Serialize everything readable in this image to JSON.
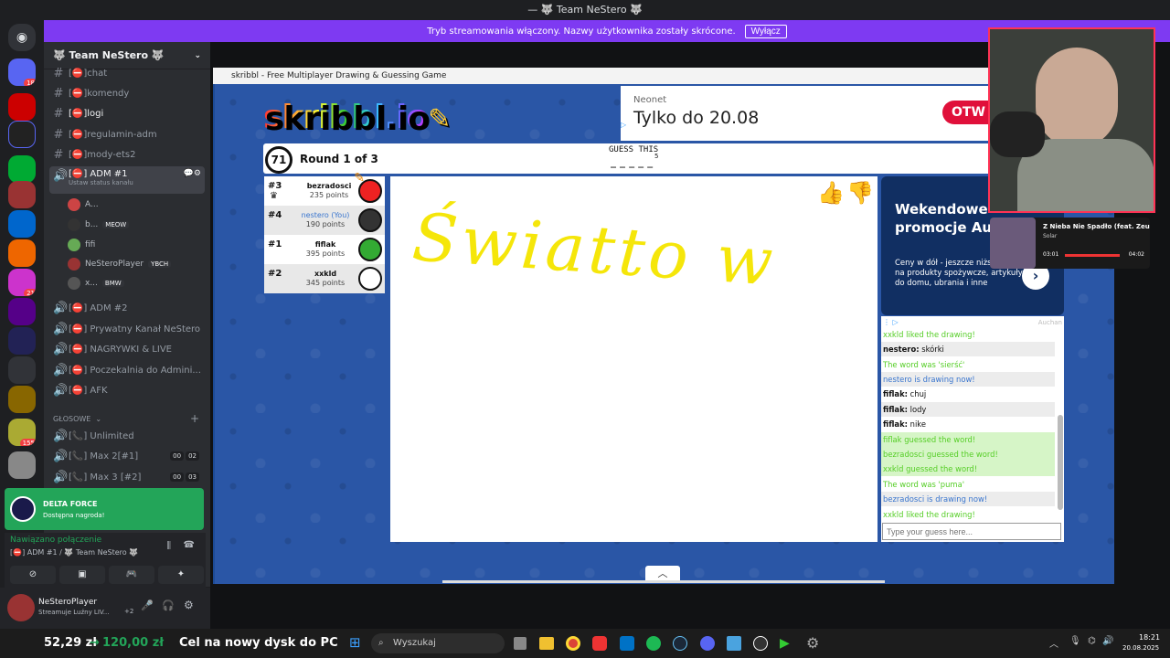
{
  "titlebar": {
    "title": "— 🐺 Team NeStero 🐺"
  },
  "banner": {
    "text": "Tryb streamowania włączony. Nazwy użytkownika zostały skrócone.",
    "button": "Wyłącz"
  },
  "server": {
    "name": "🐺 Team NeStero 🐺"
  },
  "channels": [
    {
      "label": "[⛔]chat",
      "type": "text"
    },
    {
      "label": "[⛔]komendy",
      "type": "text"
    },
    {
      "label": "[⛔]logi",
      "type": "text"
    },
    {
      "label": "[⛔]regulamin-adm",
      "type": "text"
    },
    {
      "label": "[⛔]mody-ets2",
      "type": "text"
    }
  ],
  "active_voice": {
    "label": "[⛔] ADM #1",
    "status": "Ustaw status kanału"
  },
  "voice_users": [
    {
      "name": "A...",
      "tag": ""
    },
    {
      "name": "b...",
      "tag": "MEOW"
    },
    {
      "name": "fifi",
      "tag": ""
    },
    {
      "name": "NeSteroPlayer",
      "tag": "YBCH"
    },
    {
      "name": "x...",
      "tag": "BMW"
    }
  ],
  "voice_channels": [
    {
      "label": "[⛔] ADM #2"
    },
    {
      "label": "[⛔] Prywatny Kanał NeStero"
    },
    {
      "label": "[⛔] NAGRYWKI & LIVE"
    },
    {
      "label": "[⛔] Poczekalnia do Admini..."
    },
    {
      "label": "[⛔] AFK"
    }
  ],
  "category": "GŁOSOWE",
  "glosowe": [
    {
      "label": "[📞] Unlimited",
      "c1": "",
      "c2": ""
    },
    {
      "label": "[📞] Max 2[#1]",
      "c1": "00",
      "c2": "02"
    },
    {
      "label": "[📞] Max 3 [#2]",
      "c1": "00",
      "c2": "03"
    }
  ],
  "promo": {
    "title": "DELTA FORCE",
    "sub": "Dostępna nagroda!"
  },
  "voice_status": {
    "title": "Nawiązano połączenie",
    "sub": "[⛔] ADM #1 / 🐺 Team NeStero 🐺"
  },
  "user": {
    "name": "NeSteroPlayer",
    "status": "Streamuje Luźny LIV...",
    "extra": "+2"
  },
  "game": {
    "window_title": "skribbl - Free Multiplayer Drawing & Guessing Game",
    "logo": "skribbl.io",
    "timer": "71",
    "round": "Round 1 of 3",
    "hint_label": "GUESS THIS",
    "hint": "_ _ _ _ _",
    "hint_count": "5",
    "drawing_text": "Światto w"
  },
  "ad": {
    "brand": "Neonet",
    "headline": "Tylko do 20.08",
    "cta": "OTW"
  },
  "players": [
    {
      "rank": "#3",
      "name": "bezradosci",
      "points": "235 points",
      "you": false,
      "color": "#e22"
    },
    {
      "rank": "#4",
      "name": "nestero (You)",
      "points": "190 points",
      "you": true,
      "color": "#333"
    },
    {
      "rank": "#1",
      "name": "fiflak",
      "points": "395 points",
      "you": false,
      "color": "#3a3"
    },
    {
      "rank": "#2",
      "name": "xxkld",
      "points": "345 points",
      "you": false,
      "color": "#fff"
    }
  ],
  "sidead": {
    "title": "Wekendowe promocje Auc",
    "body": "Ceny w dół - jeszcze niższe ceny na produkty spożywcze, artykuły do domu, ubrania i inne",
    "brand": "Auchan"
  },
  "music": {
    "title": "Z Nieba Nie Spadło (feat. Zeu",
    "artist": "Solar",
    "t1": "03:01",
    "t2": "04:02"
  },
  "chat": [
    {
      "who": "",
      "text": "xxkld liked the drawing!",
      "style": "g"
    },
    {
      "who": "nestero:",
      "text": " skórki",
      "style": "alt"
    },
    {
      "who": "",
      "text": "The word was 'sierść'",
      "style": "g"
    },
    {
      "who": "",
      "text": "nestero is drawing now!",
      "style": "b alt"
    },
    {
      "who": "fiflak:",
      "text": " chuj",
      "style": ""
    },
    {
      "who": "fiflak:",
      "text": " lody",
      "style": "alt"
    },
    {
      "who": "fiflak:",
      "text": " nike",
      "style": ""
    },
    {
      "who": "",
      "text": "fiflak guessed the word!",
      "style": "gbg"
    },
    {
      "who": "",
      "text": "bezradosci guessed the word!",
      "style": "gbg"
    },
    {
      "who": "",
      "text": "xxkld guessed the word!",
      "style": "gbg"
    },
    {
      "who": "",
      "text": "The word was 'puma'",
      "style": "g"
    },
    {
      "who": "",
      "text": "bezradosci is drawing now!",
      "style": "b alt"
    },
    {
      "who": "",
      "text": "xxkld liked the drawing!",
      "style": "g"
    }
  ],
  "guess_placeholder": "Type your guess here...",
  "taskbar": {
    "price": "52,29 zł",
    "arrow": "→",
    "target": "120,00 zł",
    "goal": "Cel na nowy dysk do PC",
    "search": "Wyszukaj",
    "time": "18:21",
    "date": "20.08.2025"
  },
  "colors": {
    "accent": "#7e3af2",
    "green": "#23a559",
    "chatgreen": "#56ce27",
    "chatblue": "#3975ce",
    "drawing": "#f5e60a"
  }
}
